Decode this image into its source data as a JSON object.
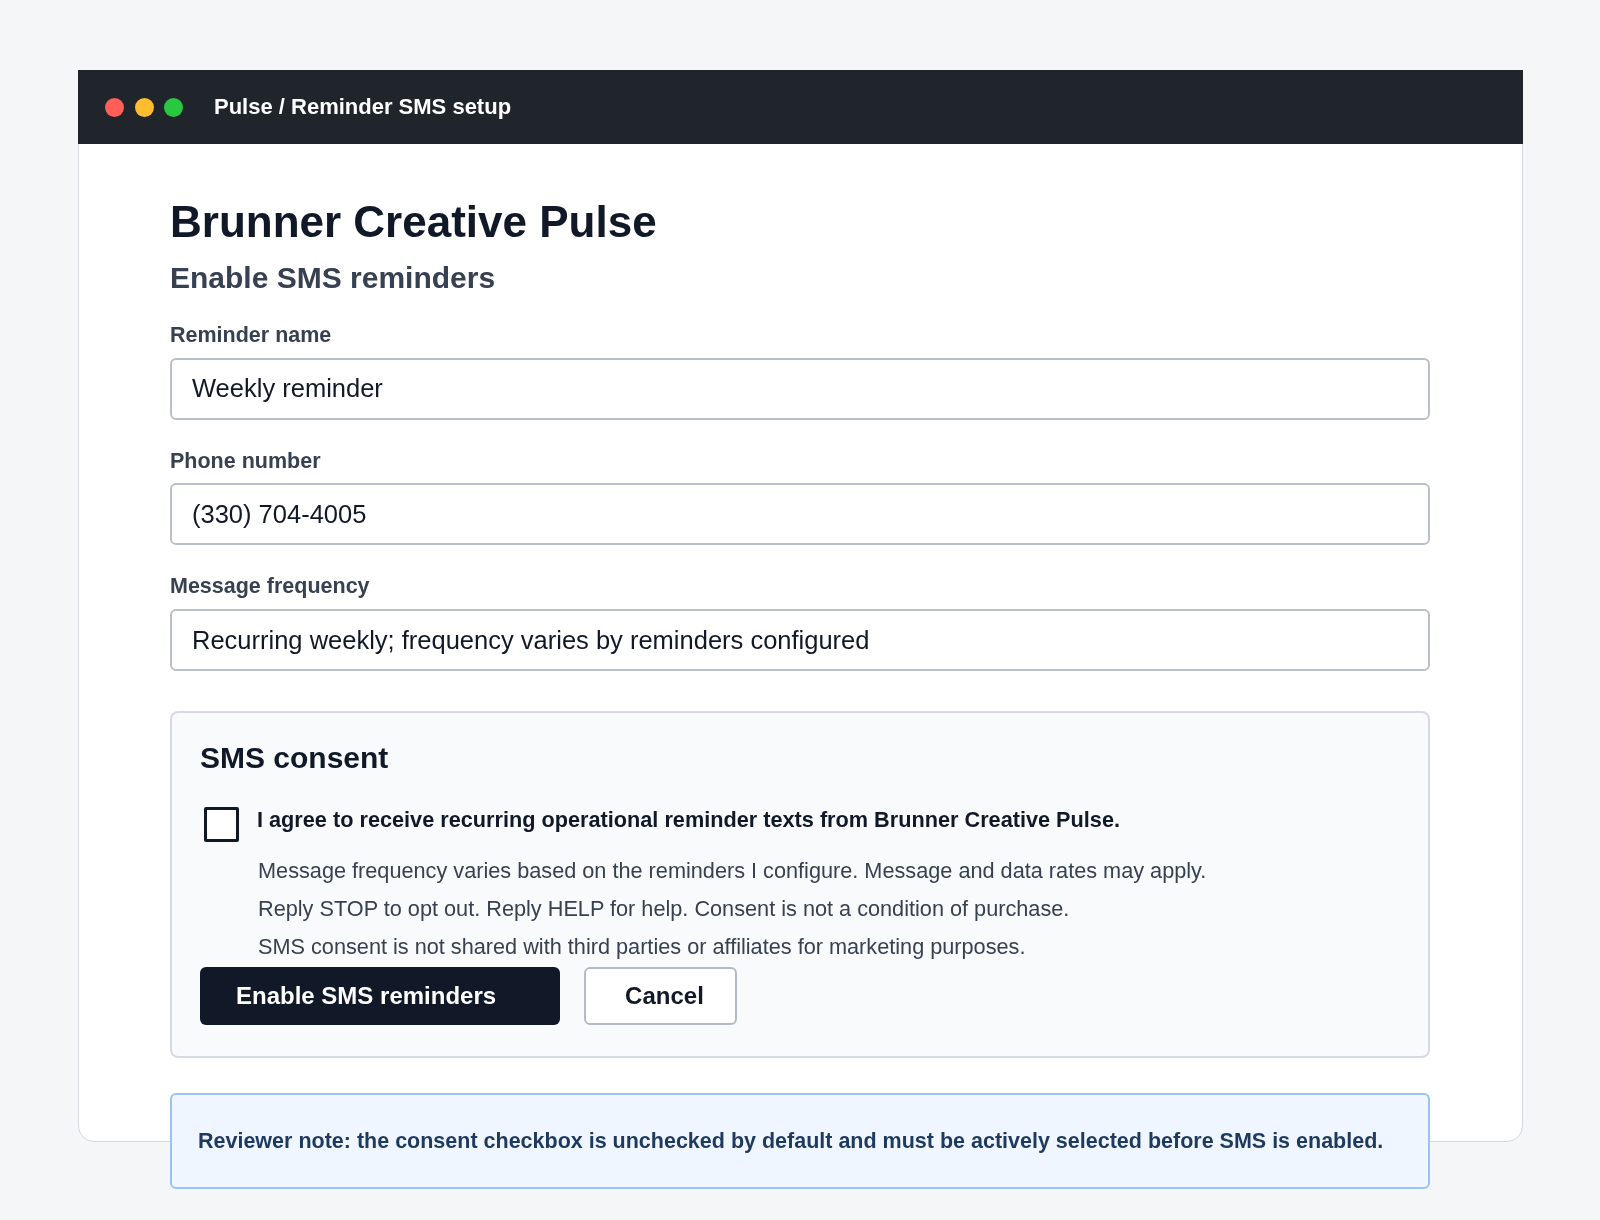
{
  "window": {
    "title": "Pulse / Reminder SMS setup"
  },
  "heading": "Brunner Creative Pulse",
  "subheading": "Enable SMS reminders",
  "fields": [
    {
      "label": "Reminder name",
      "value": "Weekly reminder"
    },
    {
      "label": "Phone number",
      "value": "(330) 704-4005"
    },
    {
      "label": "Message frequency",
      "value": "Recurring weekly; frequency varies by reminders configured"
    }
  ],
  "consent": {
    "title": "SMS consent",
    "checked": false,
    "agreement": "I agree to receive recurring operational reminder texts from Brunner Creative Pulse.",
    "details": [
      "Message frequency varies based on the reminders I configure. Message and data rates may apply.",
      "Reply STOP to opt out. Reply HELP for help. Consent is not a condition of purchase.",
      "SMS consent is not shared with third parties or affiliates for marketing purposes."
    ]
  },
  "buttons": [
    {
      "label": "Enable SMS reminders",
      "kind": "primary"
    },
    {
      "label": "Cancel",
      "kind": "secondary"
    }
  ],
  "reviewer_note": "Reviewer note: the consent checkbox is unchecked by default and must be actively selected before SMS is enabled."
}
